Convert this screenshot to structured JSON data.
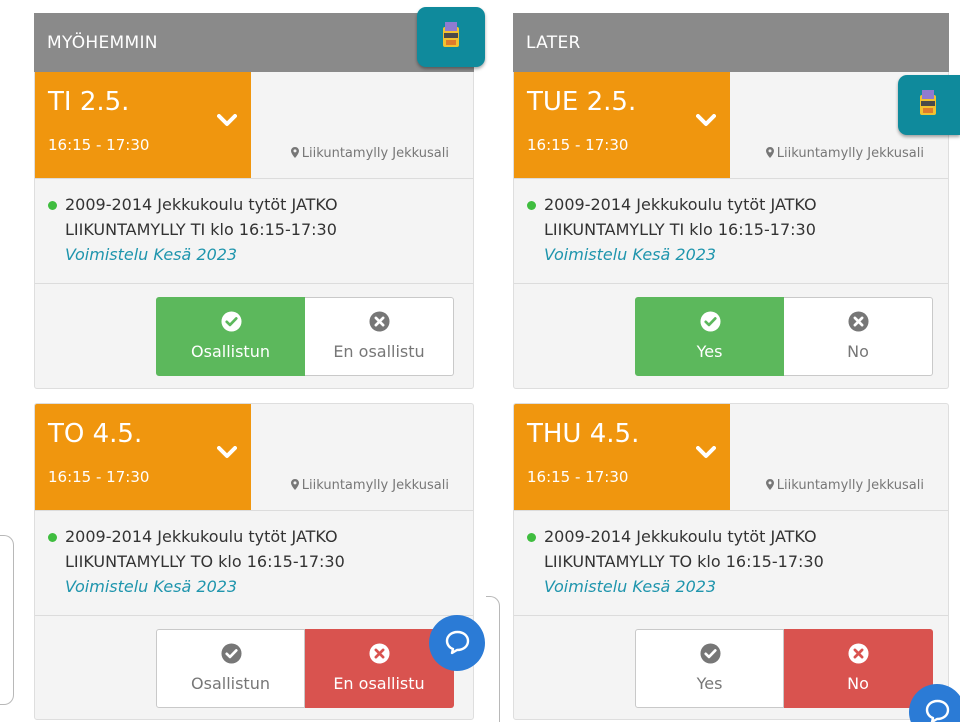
{
  "left": {
    "section_title": "MYÖHEMMIN",
    "cards": [
      {
        "date": "TI 2.5.",
        "time": "16:15 - 17:30",
        "location": "Liikuntamylly Jekkusali",
        "event_line1": "2009-2014 Jekkukoulu tytöt JATKO",
        "event_line2": "LIIKUNTAMYLLY TI klo 16:15-17:30",
        "event_sub": "Voimistelu Kesä 2023",
        "attend_label": "Osallistun",
        "decline_label": "En osallistu",
        "selected": "attend"
      },
      {
        "date": "TO 4.5.",
        "time": "16:15 - 17:30",
        "location": "Liikuntamylly Jekkusali",
        "event_line1": "2009-2014 Jekkukoulu tytöt JATKO",
        "event_line2": "LIIKUNTAMYLLY TO klo 16:15-17:30",
        "event_sub": "Voimistelu Kesä 2023",
        "attend_label": "Osallistun",
        "decline_label": "En osallistu",
        "selected": "decline"
      }
    ]
  },
  "right": {
    "section_title": "LATER",
    "cards": [
      {
        "date": "TUE 2.5.",
        "time": "16:15 - 17:30",
        "location": "Liikuntamylly Jekkusali",
        "event_line1": "2009-2014 Jekkukoulu tytöt JATKO",
        "event_line2": "LIIKUNTAMYLLY TI klo 16:15-17:30",
        "event_sub": "Voimistelu Kesä 2023",
        "attend_label": "Yes",
        "decline_label": "No",
        "selected": "attend"
      },
      {
        "date": "THU 4.5.",
        "time": "16:15 - 17:30",
        "location": "Liikuntamylly Jekkusali",
        "event_line1": "2009-2014 Jekkukoulu tytöt JATKO",
        "event_line2": "LIIKUNTAMYLLY TO klo 16:15-17:30",
        "event_sub": "Voimistelu Kesä 2023",
        "attend_label": "Yes",
        "decline_label": "No",
        "selected": "decline"
      }
    ]
  },
  "icons": {
    "badge": "club-logo-icon",
    "chat": "chat-bubble-icon",
    "pin": "map-pin-icon",
    "chevron": "chevron-down-icon",
    "check": "check-circle-icon",
    "cross": "x-circle-icon"
  },
  "colors": {
    "date_block": "#f0960e",
    "section_header": "#8a8a8a",
    "attend_selected": "#5cb85c",
    "decline_selected": "#d9534f",
    "event_sub": "#1f95ad",
    "status_dot": "#3fbd3f",
    "chat_button": "#2b7bd6",
    "club_badge": "#0f8a9c"
  }
}
